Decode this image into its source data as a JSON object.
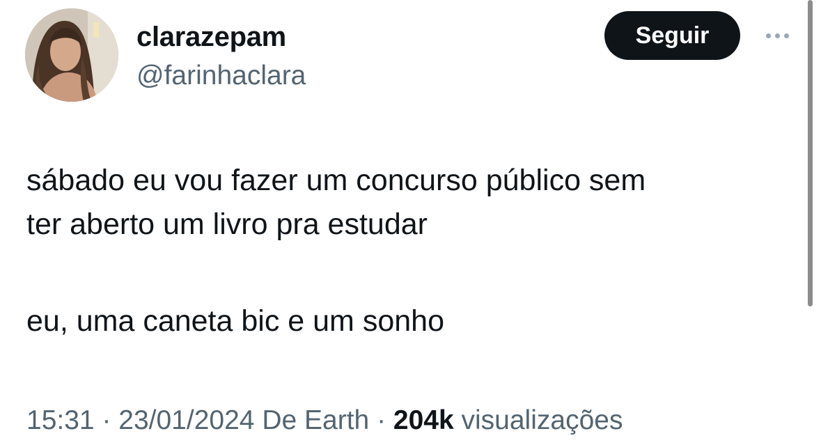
{
  "user": {
    "display_name": "clarazepam",
    "handle": "@farinhaclara",
    "avatar_icon": "profile-photo"
  },
  "actions": {
    "follow_label": "Seguir",
    "more_icon": "more-horizontal-icon"
  },
  "tweet": {
    "line1": "sábado eu vou fazer um concurso público sem",
    "line2": "ter aberto um livro pra estudar",
    "line3": "eu, uma caneta bic e um sonho"
  },
  "meta": {
    "time": "15:31",
    "separator1": " · ",
    "date": "23/01/2024",
    "source": " De Earth",
    "separator2": " · ",
    "views_count": "204k",
    "views_label": " visualizações"
  },
  "colors": {
    "text": "#0f1419",
    "secondary": "#536471",
    "button_bg": "#0f1419",
    "button_text": "#ffffff"
  }
}
